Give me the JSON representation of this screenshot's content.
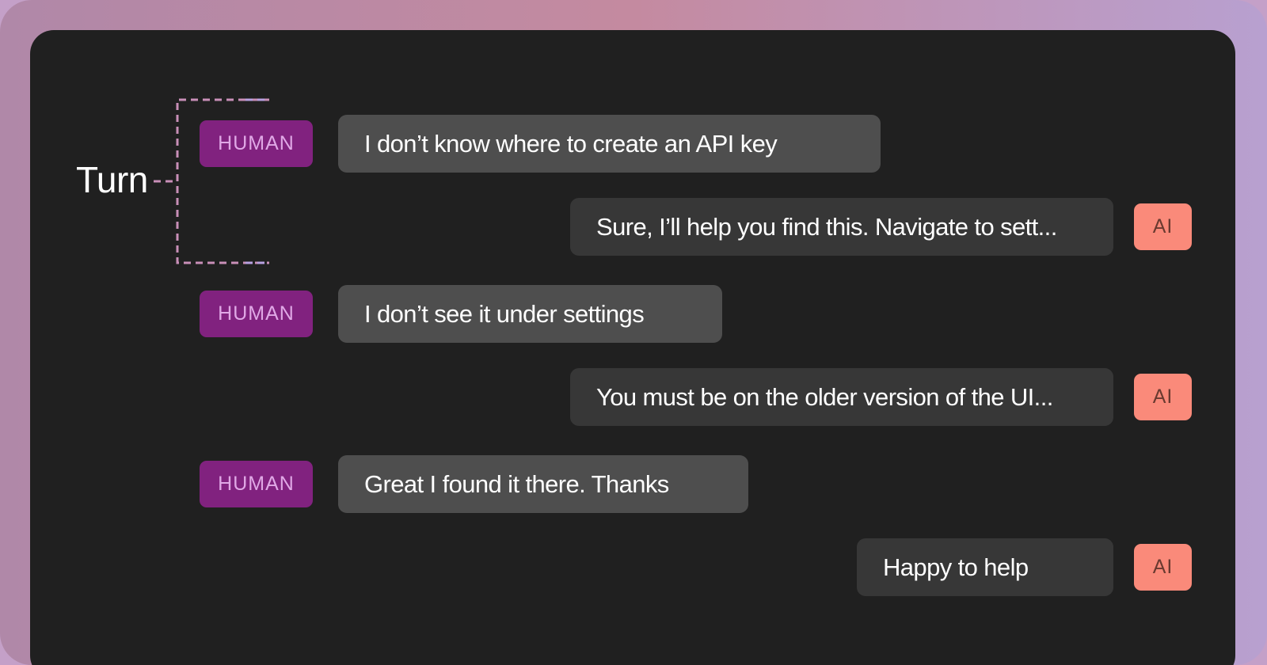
{
  "turn_label": "Turn",
  "colors": {
    "human_chip_bg": "#81227f",
    "human_chip_text": "#e0a8e6",
    "ai_chip_bg": "#fa8a7a",
    "ai_chip_text": "#6a3a30",
    "panel_bg": "#202020",
    "bracket_stroke": "#c98fb8"
  },
  "messages": [
    {
      "role": "human",
      "role_label": "HUMAN",
      "text": "I don’t know where to create an API key"
    },
    {
      "role": "ai",
      "role_label": "AI",
      "text": "Sure, I’ll help you find this. Navigate to sett..."
    },
    {
      "role": "human",
      "role_label": "HUMAN",
      "text": "I don’t see it under settings"
    },
    {
      "role": "ai",
      "role_label": "AI",
      "text": "You must be on the older version of the UI..."
    },
    {
      "role": "human",
      "role_label": "HUMAN",
      "text": "Great I found it there. Thanks"
    },
    {
      "role": "ai",
      "role_label": "AI",
      "text": "Happy to help"
    }
  ]
}
